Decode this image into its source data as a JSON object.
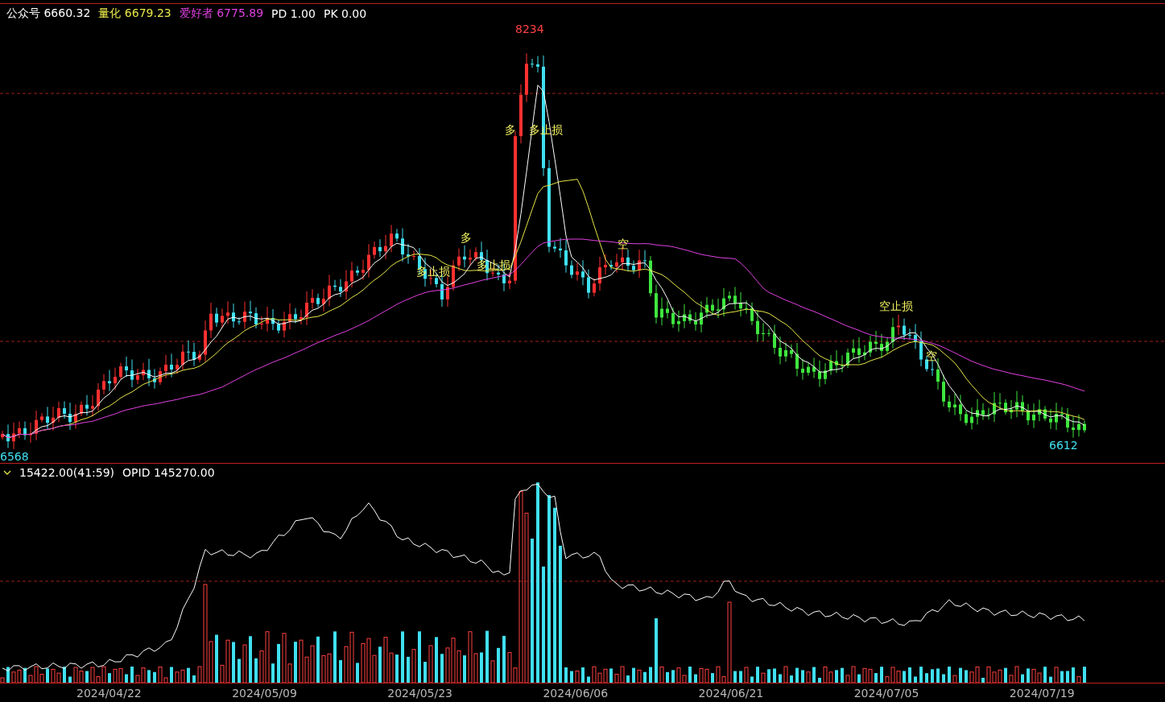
{
  "header": {
    "indicators": [
      {
        "label": "公众号",
        "value": "6660.32",
        "color": "#ffffff"
      },
      {
        "label": "量化",
        "value": "6679.23",
        "color": "#e6e64a"
      },
      {
        "label": "爱好者",
        "value": "6775.89",
        "color": "#e040e0"
      },
      {
        "label": "PD",
        "value": "1.00",
        "color": "#ffffff"
      },
      {
        "label": "PK",
        "value": "0.00",
        "color": "#ffffff"
      }
    ]
  },
  "main_chart": {
    "high_label": "8234",
    "low_label": "6568",
    "last_low_label": "6612",
    "signals": [
      {
        "label": "多止损"
      },
      {
        "label": "多"
      },
      {
        "label": "多止损"
      },
      {
        "label": "多"
      },
      {
        "label": "多止损"
      },
      {
        "label": "空"
      },
      {
        "label": "空止损"
      },
      {
        "label": "空"
      }
    ]
  },
  "sub_chart": {
    "reading": "15422.00(41:59)",
    "opid": "OPID 145270.00"
  },
  "x_axis": {
    "labels": [
      "2024/04/22",
      "2024/05/09",
      "2024/05/23",
      "2024/06/06",
      "2024/06/21",
      "2024/07/05",
      "2024/07/19"
    ]
  }
}
